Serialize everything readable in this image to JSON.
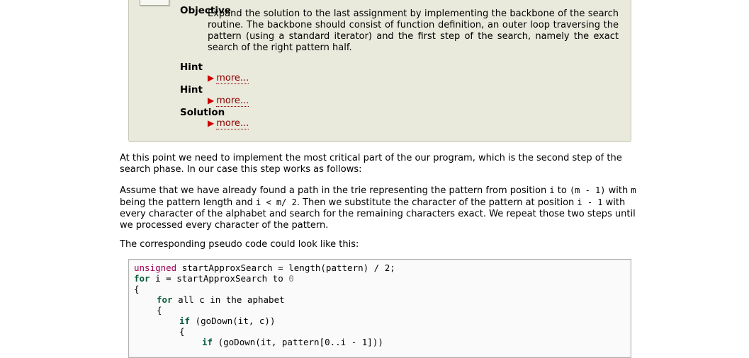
{
  "assignment": {
    "objective_label": "Objective",
    "objective_text": "Expand the solution to the last assignment by implementing the backbone of the search routine. The backbone should consist of function definition, an outer loop traversing the pattern (using a standard iterator) and the first step of the search, namely the exact search of the right pattern half.",
    "hint1_label": "Hint",
    "hint2_label": "Hint",
    "solution_label": "Solution",
    "more_label": "more..."
  },
  "text": {
    "para1": "At this point we need to implement the most critical part of the our program, which is the second step of the search phase. In our case this step works as follows:",
    "para2_a": "Assume that we have already found a path in the trie representing the pattern from position ",
    "para2_code1": "i",
    "para2_b": " to ",
    "para2_code2": "(m - 1)",
    "para2_c": " with ",
    "para2_code3": "m",
    "para2_d": " being the pattern length and ",
    "para2_code4": "i < m/ 2",
    "para2_e": ". Then we substitute the character of the pattern at position ",
    "para2_code5": "i - 1",
    "para2_f": " with every character of the alphabet and search for the remaining characters exact. We repeat those two steps until we processed every character of the pattern.",
    "para3": "The corresponding pseudo code could look like this:"
  },
  "code": {
    "l1_kw": "unsigned",
    "l1_rest": " startApproxSearch = length(pattern) / 2;",
    "l2_kw": "for",
    "l2_rest": " i = startApproxSearch to ",
    "l2_num": "0",
    "l3": "{",
    "l4_kw": "for",
    "l4_rest": " all c in the aphabet",
    "l5": "{",
    "l6_kw": "if",
    "l6_rest": " (goDown(it, c))",
    "l7": "{",
    "l8_kw": "if",
    "l8_rest": " (goDown(it, pattern[0..i - 1]))"
  }
}
